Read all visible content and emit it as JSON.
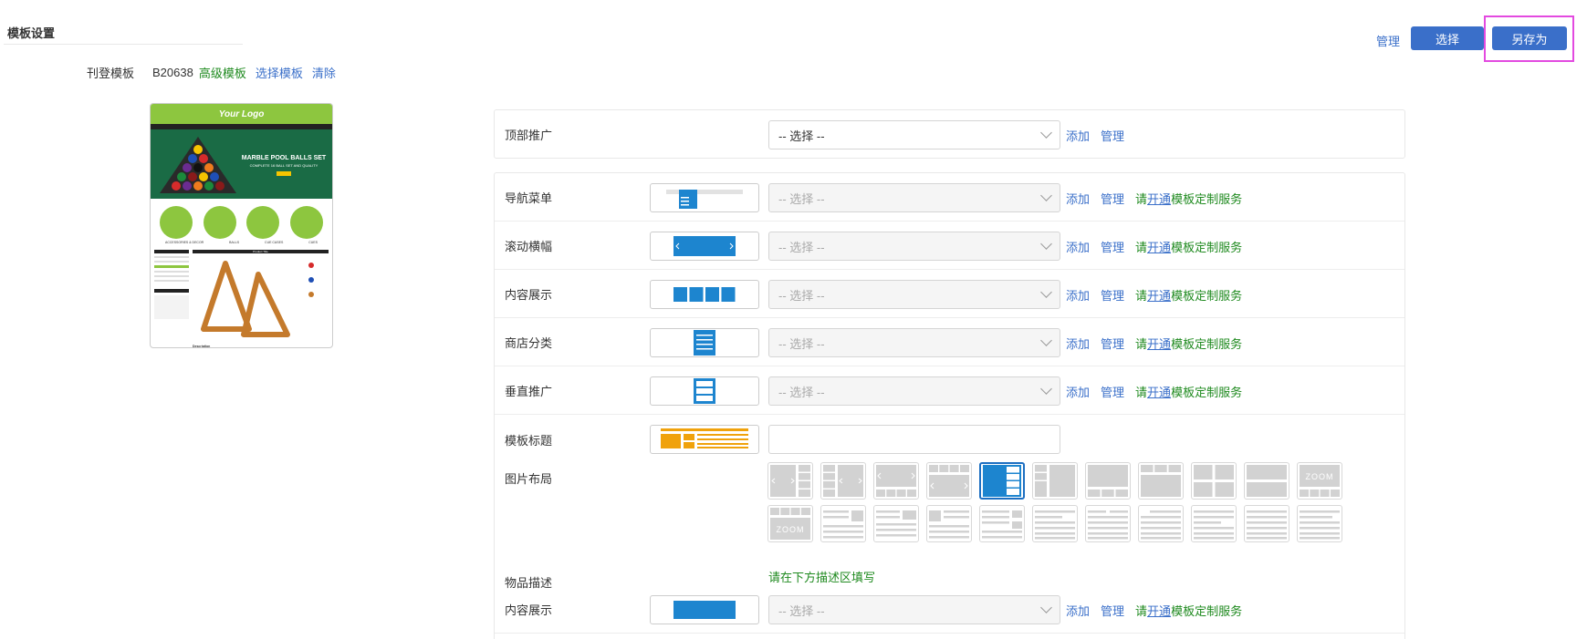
{
  "page": {
    "title": "模板设置",
    "toolbar": {
      "manage": "管理",
      "select": "选择",
      "save_as": "另存为"
    }
  },
  "template": {
    "label": "刊登模板",
    "code": "B20638",
    "level": "高级模板",
    "select_link": "选择模板",
    "clear_link": "清除"
  },
  "thumbnail": {
    "logo": "Your Logo",
    "banner_title": "MARBLE POOL BALLS SET",
    "banner_sub": "COMPLETE 16 BALL SET AND QUALITY",
    "cats": [
      "ACCESSORIES & DECOR",
      "BALLS",
      "CUE CASES",
      "CUES"
    ],
    "product_title": "Product Title",
    "desc_heading": "Description"
  },
  "top_promo": {
    "label": "顶部推广",
    "placeholder": "-- 选择 --",
    "add": "添加",
    "manage": "管理"
  },
  "rows": [
    {
      "label": "导航菜单",
      "placeholder": "-- 选择 --",
      "add": "添加",
      "manage": "管理",
      "svc_pre": "请",
      "svc_link": "开通",
      "svc_post": "模板定制服务"
    },
    {
      "label": "滚动横幅",
      "placeholder": "-- 选择 --",
      "add": "添加",
      "manage": "管理",
      "svc_pre": "请",
      "svc_link": "开通",
      "svc_post": "模板定制服务"
    },
    {
      "label": "内容展示",
      "placeholder": "-- 选择 --",
      "add": "添加",
      "manage": "管理",
      "svc_pre": "请",
      "svc_link": "开通",
      "svc_post": "模板定制服务"
    },
    {
      "label": "商店分类",
      "placeholder": "-- 选择 --",
      "add": "添加",
      "manage": "管理",
      "svc_pre": "请",
      "svc_link": "开通",
      "svc_post": "模板定制服务"
    },
    {
      "label": "垂直推广",
      "placeholder": "-- 选择 --",
      "add": "添加",
      "manage": "管理",
      "svc_pre": "请",
      "svc_link": "开通",
      "svc_post": "模板定制服务"
    }
  ],
  "template_title": {
    "label": "模板标题",
    "value": ""
  },
  "image_layout": {
    "label": "图片布局",
    "zoom_text": "ZOOM",
    "selected_index": 4
  },
  "item_desc": {
    "label": "物品描述",
    "note": "请在下方描述区填写"
  },
  "content_bottom": {
    "label": "内容展示",
    "placeholder": "-- 选择 --",
    "add": "添加",
    "manage": "管理",
    "svc_pre": "请",
    "svc_link": "开通",
    "svc_post": "模板定制服务"
  },
  "colors": {
    "primary": "#3a6fc9",
    "green": "#1f8a1f",
    "highlight": "#e34ae0",
    "blue_icon": "#1d85cf",
    "orange_icon": "#f0a20c"
  }
}
